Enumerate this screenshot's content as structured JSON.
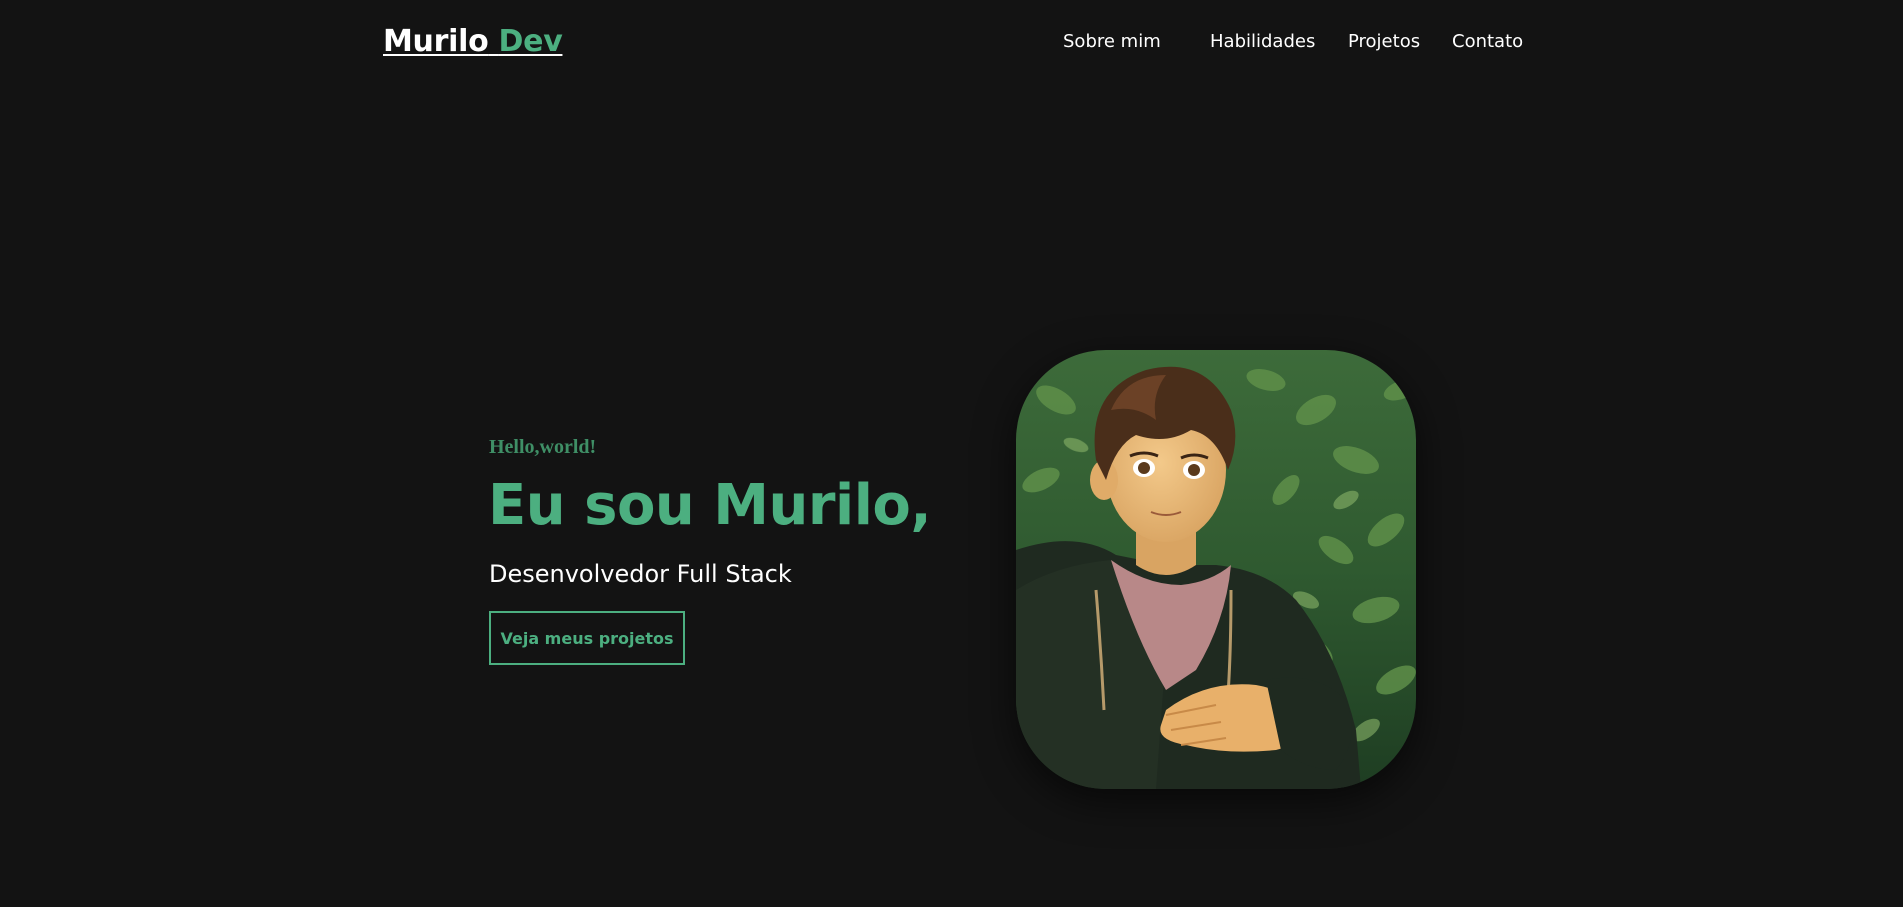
{
  "header": {
    "logo_main": "Murilo",
    "logo_accent": "Dev",
    "nav": [
      {
        "label": "Sobre mim"
      },
      {
        "label": "Habilidades"
      },
      {
        "label": "Projetos"
      },
      {
        "label": "Contato"
      }
    ]
  },
  "hero": {
    "greeting": "Hello,world!",
    "headline": "Eu sou Murilo,",
    "subtitle": "Desenvolvedor Full Stack",
    "cta_label": "Veja meus projetos"
  },
  "colors": {
    "background": "#131313",
    "accent": "#4caf80",
    "text": "#ffffff"
  }
}
